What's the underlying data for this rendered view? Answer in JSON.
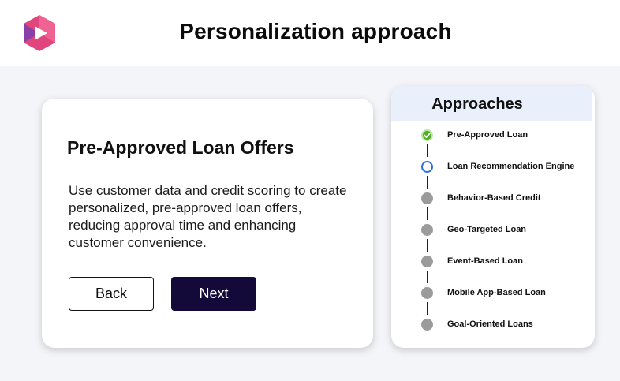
{
  "header": {
    "title": "Personalization approach",
    "logo_icon": "play-hexagon-logo",
    "logo_colors": [
      "#e0457b",
      "#8b3fa8",
      "#f06292"
    ]
  },
  "detail": {
    "title": "Pre-Approved Loan Offers",
    "description": "Use customer data and credit scoring to create personalized, pre-approved loan offers, reducing approval time and enhancing customer convenience.",
    "back_label": "Back",
    "next_label": "Next"
  },
  "approaches": {
    "title": "Approaches",
    "items": [
      {
        "label": "Pre-Approved Loan",
        "status": "done"
      },
      {
        "label": "Loan Recommendation Engine",
        "status": "current"
      },
      {
        "label": "Behavior-Based Credit",
        "status": "pending"
      },
      {
        "label": "Geo-Targeted Loan",
        "status": "pending"
      },
      {
        "label": "Event-Based Loan",
        "status": "pending"
      },
      {
        "label": "Mobile App-Based Loan",
        "status": "pending"
      },
      {
        "label": "Goal-Oriented Loans",
        "status": "pending"
      }
    ]
  },
  "colors": {
    "primary_button": "#140a3a",
    "done": "#4caf1f",
    "current": "#2d6ee6",
    "pending": "#9b9b9b",
    "panel_header": "#eaf0fb"
  }
}
